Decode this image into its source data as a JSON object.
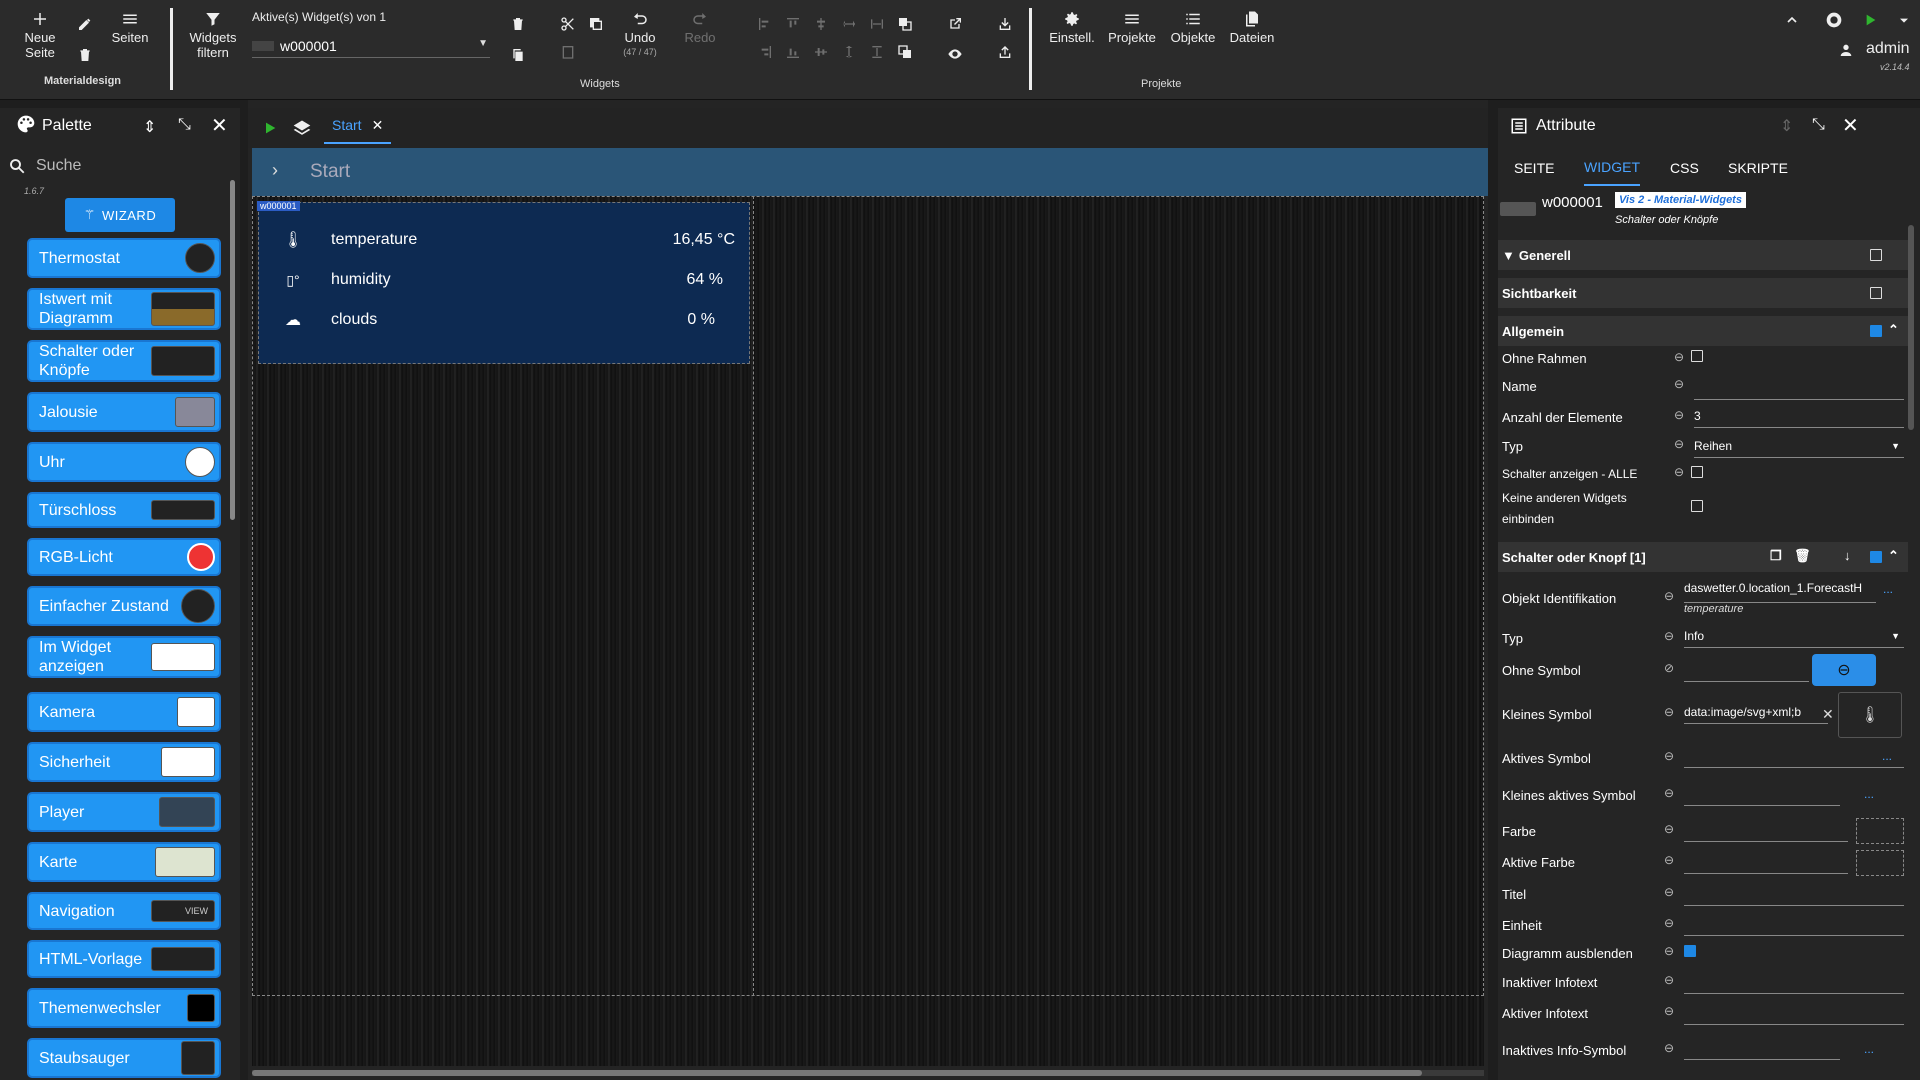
{
  "toolbar": {
    "new_page": "Neue\nSeite",
    "pages": "Seiten",
    "material_label": "Materialdesign",
    "widgets_filter": "Widgets\nfiltern",
    "active_widgets": "Aktive(s) Widget(s) von 1",
    "widget_id": "w000001",
    "undo_label": "Undo",
    "undo_count": "(47 / 47)",
    "redo_label": "Redo",
    "widgets_group": "Widgets",
    "settings": "Einstell.",
    "projects": "Projekte",
    "objects": "Objekte",
    "files": "Dateien",
    "projects_group": "Projekte",
    "user": "admin",
    "version": "v2.14.4"
  },
  "palette": {
    "title": "Palette",
    "search_placeholder": "Suche",
    "version": "1.6.7",
    "wizard": "WIZARD",
    "items": [
      {
        "label": "Thermostat"
      },
      {
        "label": "Istwert mit Diagramm"
      },
      {
        "label": "Schalter oder Knöpfe"
      },
      {
        "label": "Jalousie"
      },
      {
        "label": "Uhr"
      },
      {
        "label": "Türschloss"
      },
      {
        "label": "RGB-Licht"
      },
      {
        "label": "Einfacher Zustand"
      },
      {
        "label": "Im Widget anzeigen"
      },
      {
        "label": "Kamera"
      },
      {
        "label": "Sicherheit"
      },
      {
        "label": "Player"
      },
      {
        "label": "Karte"
      },
      {
        "label": "Navigation"
      },
      {
        "label": "HTML-Vorlage"
      },
      {
        "label": "Themenwechsler"
      },
      {
        "label": "Staubsauger"
      }
    ],
    "nav_thumb": "VIEW"
  },
  "editor": {
    "tab": "Start",
    "breadcrumb": "Start",
    "widget_tag": "w000001",
    "rows": [
      {
        "label": "temperature",
        "value": "16,45 °C"
      },
      {
        "label": "humidity",
        "value": "64 %"
      },
      {
        "label": "clouds",
        "value": "0 %"
      }
    ]
  },
  "attrs": {
    "title": "Attribute",
    "tabs": [
      "SEITE",
      "WIDGET",
      "CSS",
      "SKRIPTE"
    ],
    "widget_id": "w000001",
    "set_name": "Vis 2 - Material-Widgets",
    "widget_type": "Schalter oder Knöpfe",
    "sections": {
      "general": "Generell",
      "visibility": "Sichtbarkeit",
      "common": "Allgemein",
      "switch": "Schalter oder Knopf [1]"
    },
    "common_rows": {
      "no_frame": "Ohne Rahmen",
      "name": "Name",
      "count_label": "Anzahl der Elemente",
      "count_value": "3",
      "type_label": "Typ",
      "type_value": "Reihen",
      "show_all": "Schalter anzeigen - ALLE",
      "no_other": "Keine anderen Widgets einbinden"
    },
    "switch_rows": {
      "oid_label": "Objekt Identifikation",
      "oid_value": "daswetter.0.location_1.ForecastH",
      "oid_sub": "temperature",
      "type_label": "Typ",
      "type_value": "Info",
      "no_symbol": "Ohne Symbol",
      "small_symbol": "Kleines Symbol",
      "small_symbol_value": "data:image/svg+xml;b",
      "active_symbol": "Aktives Symbol",
      "small_active_symbol": "Kleines aktives Symbol",
      "color": "Farbe",
      "active_color": "Aktive Farbe",
      "title": "Titel",
      "unit": "Einheit",
      "hide_chart": "Diagramm ausblenden",
      "inactive_info": "Inaktiver Infotext",
      "active_info": "Aktiver Infotext",
      "inactive_info_symbol": "Inaktives Info-Symbol"
    },
    "dots": "..."
  },
  "colors": {
    "accent": "#2196f3",
    "breadcrumb": "#2a5577",
    "widget_bg": "#0d2a52",
    "active_tab": "#4aa3ff"
  }
}
